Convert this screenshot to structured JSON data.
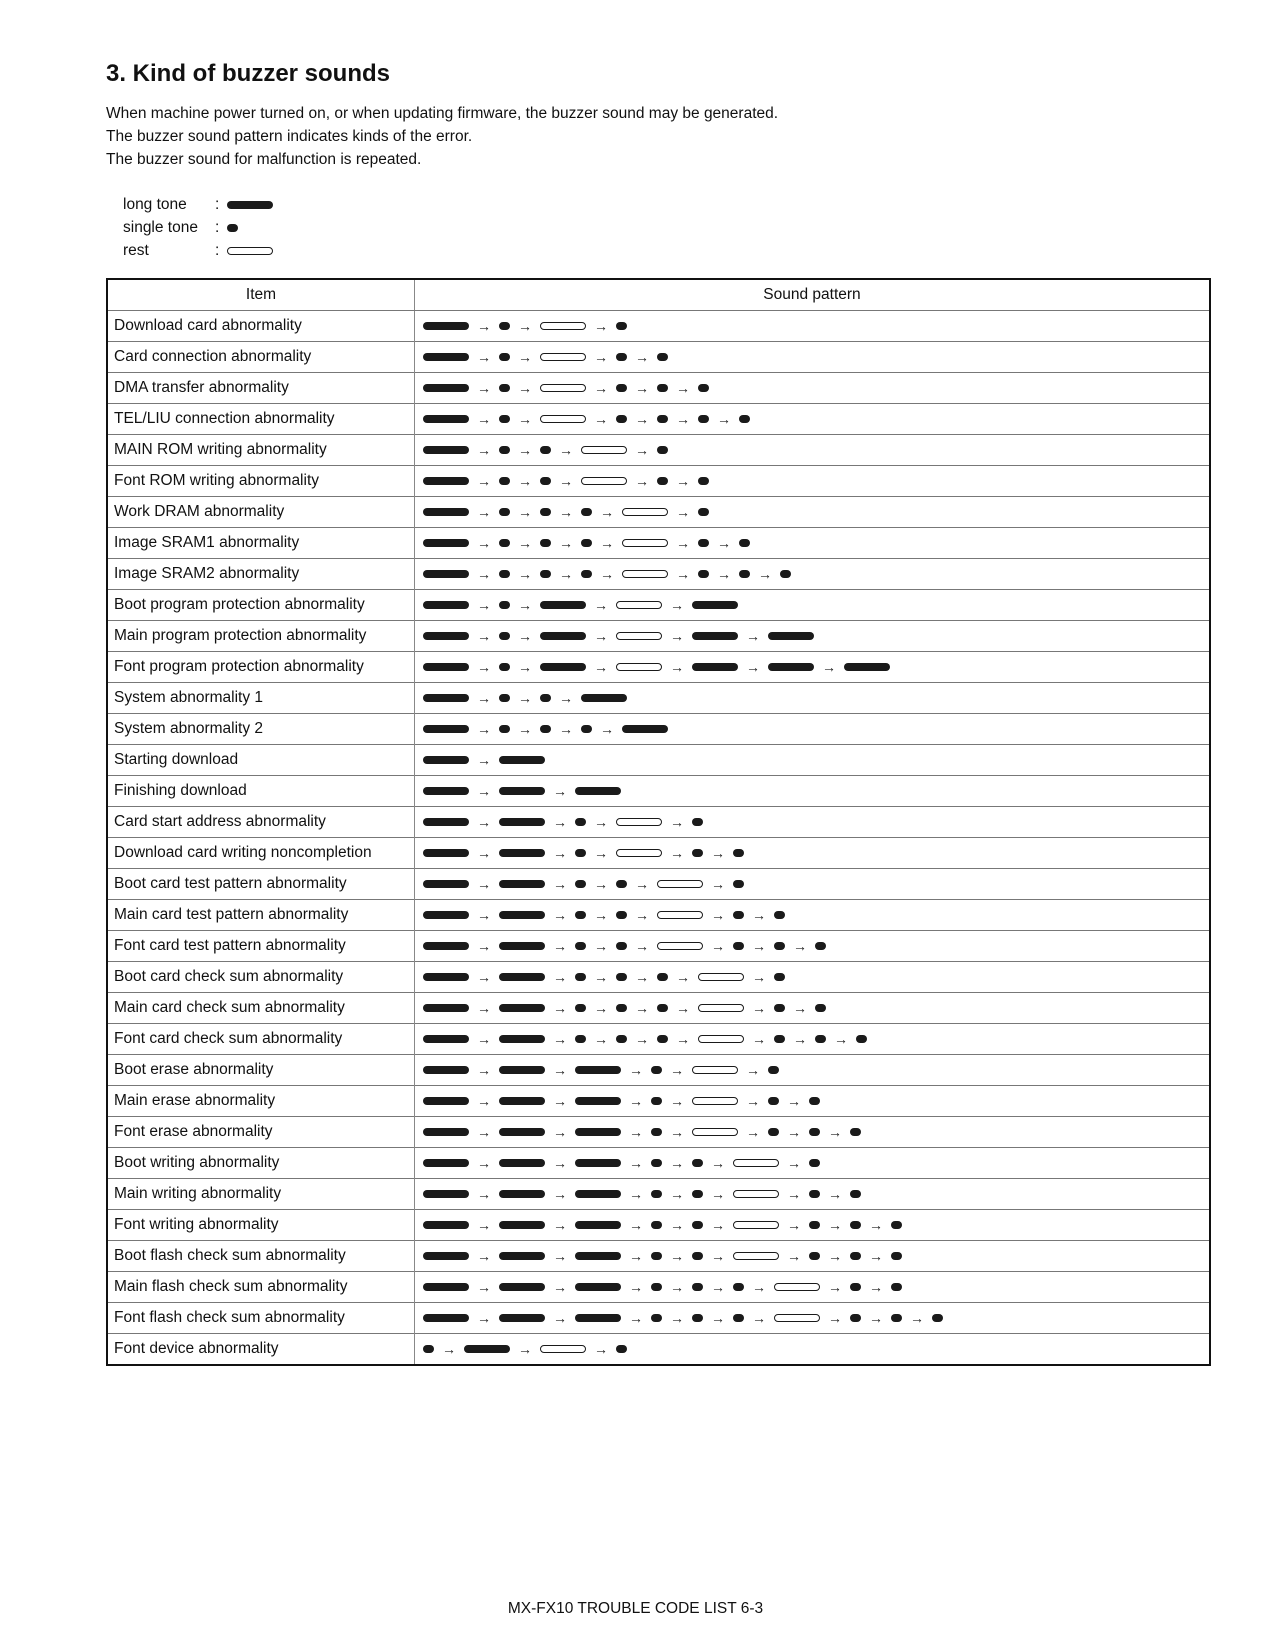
{
  "title": "3. Kind of buzzer sounds",
  "intro": [
    "When machine power turned on, or when updating firmware, the buzzer sound may be generated.",
    "The buzzer sound pattern indicates kinds of the error.",
    "The buzzer sound for malfunction is repeated."
  ],
  "legend": [
    {
      "label": "long tone",
      "symbol": "long"
    },
    {
      "label": "single tone",
      "symbol": "single"
    },
    {
      "label": "rest",
      "symbol": "rest"
    }
  ],
  "legend_separator": ":",
  "arrow_glyph": "→",
  "table": {
    "headers": {
      "item": "Item",
      "pattern": "Sound pattern"
    },
    "pattern_key": {
      "L": "long tone",
      "S": "single tone",
      "R": "rest"
    },
    "rows": [
      {
        "item": "Download card abnormality",
        "pattern": "LSRS"
      },
      {
        "item": "Card connection abnormality",
        "pattern": "LSRSS"
      },
      {
        "item": "DMA transfer abnormality",
        "pattern": "LSRSSS"
      },
      {
        "item": "TEL/LIU connection abnormality",
        "pattern": "LSRSSSS"
      },
      {
        "item": "MAIN ROM writing abnormality",
        "pattern": "LSSRS"
      },
      {
        "item": "Font ROM writing abnormality",
        "pattern": "LSSRSS"
      },
      {
        "item": "Work DRAM abnormality",
        "pattern": "LSSSRS"
      },
      {
        "item": "Image SRAM1 abnormality",
        "pattern": "LSSSRSS"
      },
      {
        "item": "Image SRAM2 abnormality",
        "pattern": "LSSSRSSS"
      },
      {
        "item": "Boot program protection abnormality",
        "pattern": "LSLRL"
      },
      {
        "item": "Main program protection abnormality",
        "pattern": "LSLRLL"
      },
      {
        "item": "Font program protection abnormality",
        "pattern": "LSLRLLL"
      },
      {
        "item": "System abnormality 1",
        "pattern": "LSSL"
      },
      {
        "item": "System abnormality 2",
        "pattern": "LSSSL"
      },
      {
        "item": "Starting download",
        "pattern": "LL"
      },
      {
        "item": "Finishing download",
        "pattern": "LLL"
      },
      {
        "item": "Card start address abnormality",
        "pattern": "LLSRS"
      },
      {
        "item": "Download card writing noncompletion",
        "pattern": "LLSRSS"
      },
      {
        "item": "Boot card test pattern abnormality",
        "pattern": "LLSSRS"
      },
      {
        "item": "Main card test pattern abnormality",
        "pattern": "LLSSRSS"
      },
      {
        "item": "Font card test pattern abnormality",
        "pattern": "LLSSRSSS"
      },
      {
        "item": "Boot card check sum abnormality",
        "pattern": "LLSSSRS"
      },
      {
        "item": "Main card check sum abnormality",
        "pattern": "LLSSSRSS"
      },
      {
        "item": "Font card check sum abnormality",
        "pattern": "LLSSSRSSS"
      },
      {
        "item": "Boot erase abnormality",
        "pattern": "LLLSRS"
      },
      {
        "item": "Main erase abnormality",
        "pattern": "LLLSRSS"
      },
      {
        "item": "Font erase abnormality",
        "pattern": "LLLSRSSS"
      },
      {
        "item": "Boot writing abnormality",
        "pattern": "LLLSSRS"
      },
      {
        "item": "Main writing abnormality",
        "pattern": "LLLSSRSS"
      },
      {
        "item": "Font writing abnormality",
        "pattern": "LLLSSRSSS"
      },
      {
        "item": "Boot flash check sum abnormality",
        "pattern": "LLLSSRSSS"
      },
      {
        "item": "Main flash check sum abnormality",
        "pattern": "LLLSSSRSS"
      },
      {
        "item": "Font flash check sum abnormality",
        "pattern": "LLLSSSRSSS"
      },
      {
        "item": "Font device abnormality",
        "pattern": "SLRS"
      }
    ]
  },
  "footer": "MX-FX10 TROUBLE CODE LIST 6-3"
}
